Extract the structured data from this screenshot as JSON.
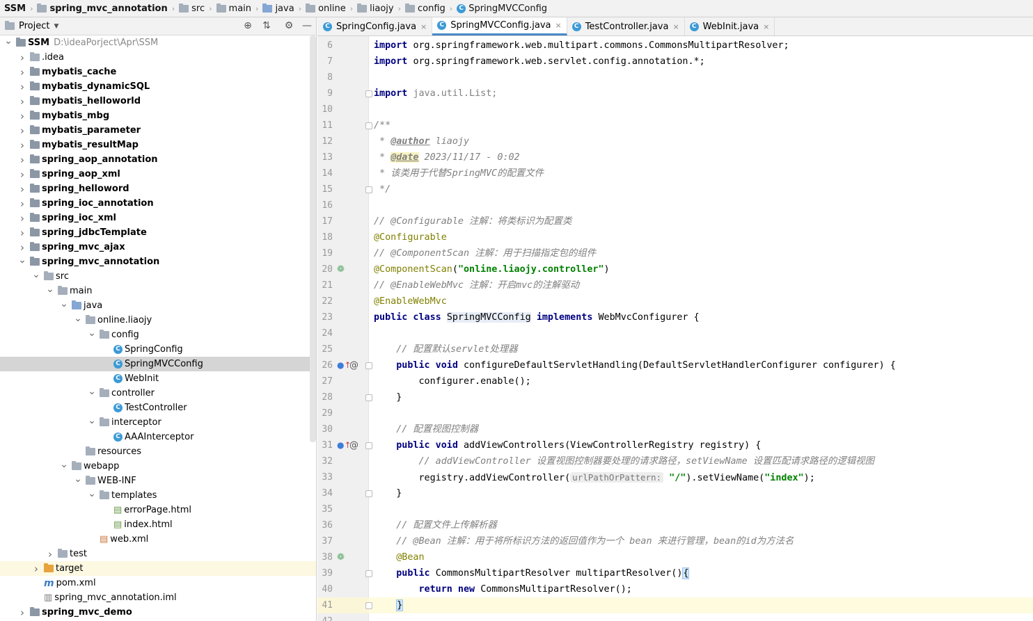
{
  "breadcrumb": [
    "SSM",
    "spring_mvc_annotation",
    "src",
    "main",
    "java",
    "online",
    "liaojy",
    "config",
    "SpringMVCConfig"
  ],
  "sidebar": {
    "title": "Project",
    "tree": [
      {
        "label": "SSM",
        "path": "D:\\ideaPorject\\Apr\\SSM",
        "kind": "project",
        "depth": 0,
        "open": true,
        "bold": true
      },
      {
        "label": ".idea",
        "kind": "folder",
        "depth": 1,
        "closed": true
      },
      {
        "label": "mybatis_cache",
        "kind": "module",
        "depth": 1,
        "closed": true,
        "bold": true
      },
      {
        "label": "mybatis_dynamicSQL",
        "kind": "module",
        "depth": 1,
        "closed": true,
        "bold": true
      },
      {
        "label": "mybatis_helloworld",
        "kind": "module",
        "depth": 1,
        "closed": true,
        "bold": true
      },
      {
        "label": "mybatis_mbg",
        "kind": "module",
        "depth": 1,
        "closed": true,
        "bold": true
      },
      {
        "label": "mybatis_parameter",
        "kind": "module",
        "depth": 1,
        "closed": true,
        "bold": true
      },
      {
        "label": "mybatis_resultMap",
        "kind": "module",
        "depth": 1,
        "closed": true,
        "bold": true
      },
      {
        "label": "spring_aop_annotation",
        "kind": "module",
        "depth": 1,
        "closed": true,
        "bold": true
      },
      {
        "label": "spring_aop_xml",
        "kind": "module",
        "depth": 1,
        "closed": true,
        "bold": true
      },
      {
        "label": "spring_helloword",
        "kind": "module",
        "depth": 1,
        "closed": true,
        "bold": true
      },
      {
        "label": "spring_ioc_annotation",
        "kind": "module",
        "depth": 1,
        "closed": true,
        "bold": true
      },
      {
        "label": "spring_ioc_xml",
        "kind": "module",
        "depth": 1,
        "closed": true,
        "bold": true
      },
      {
        "label": "spring_jdbcTemplate",
        "kind": "module",
        "depth": 1,
        "closed": true,
        "bold": true
      },
      {
        "label": "spring_mvc_ajax",
        "kind": "module",
        "depth": 1,
        "closed": true,
        "bold": true
      },
      {
        "label": "spring_mvc_annotation",
        "kind": "module",
        "depth": 1,
        "open": true,
        "bold": true
      },
      {
        "label": "src",
        "kind": "folder",
        "depth": 2,
        "open": true
      },
      {
        "label": "main",
        "kind": "folder",
        "depth": 3,
        "open": true
      },
      {
        "label": "java",
        "kind": "folder-blue",
        "depth": 4,
        "open": true
      },
      {
        "label": "online.liaojy",
        "kind": "folder",
        "depth": 5,
        "open": true
      },
      {
        "label": "config",
        "kind": "folder",
        "depth": 6,
        "open": true
      },
      {
        "label": "SpringConfig",
        "kind": "class",
        "depth": 7
      },
      {
        "label": "SpringMVCConfig",
        "kind": "class",
        "depth": 7,
        "selected": true
      },
      {
        "label": "WebInit",
        "kind": "class",
        "depth": 7
      },
      {
        "label": "controller",
        "kind": "folder",
        "depth": 6,
        "open": true
      },
      {
        "label": "TestController",
        "kind": "class",
        "depth": 7
      },
      {
        "label": "interceptor",
        "kind": "folder",
        "depth": 6,
        "open": true
      },
      {
        "label": "AAAInterceptor",
        "kind": "class",
        "depth": 7
      },
      {
        "label": "resources",
        "kind": "folder",
        "depth": 5
      },
      {
        "label": "webapp",
        "kind": "folder",
        "depth": 4,
        "open": true
      },
      {
        "label": "WEB-INF",
        "kind": "folder",
        "depth": 5,
        "open": true
      },
      {
        "label": "templates",
        "kind": "folder",
        "depth": 6,
        "open": true
      },
      {
        "label": "errorPage.html",
        "kind": "html",
        "depth": 7
      },
      {
        "label": "index.html",
        "kind": "html",
        "depth": 7
      },
      {
        "label": "web.xml",
        "kind": "xml",
        "depth": 6
      },
      {
        "label": "test",
        "kind": "folder",
        "depth": 3,
        "closed": true
      },
      {
        "label": "target",
        "kind": "folder-orange",
        "depth": 2,
        "closed": true,
        "target": true
      },
      {
        "label": "pom.xml",
        "kind": "maven",
        "depth": 2
      },
      {
        "label": "spring_mvc_annotation.iml",
        "kind": "iml",
        "depth": 2
      },
      {
        "label": "spring_mvc_demo",
        "kind": "module",
        "depth": 1,
        "closed": true,
        "bold": true
      }
    ]
  },
  "tabs": [
    {
      "label": "SpringConfig.java",
      "active": false
    },
    {
      "label": "SpringMVCConfig.java",
      "active": true
    },
    {
      "label": "TestController.java",
      "active": false
    },
    {
      "label": "WebInit.java",
      "active": false
    }
  ],
  "editor": {
    "lines": [
      {
        "n": 6,
        "s": [
          [
            "kw",
            "import"
          ],
          [
            "",
            "org.springframework.web.multipart.commons.CommonsMultipartResolver;"
          ]
        ]
      },
      {
        "n": 7,
        "s": [
          [
            "kw",
            "import"
          ],
          [
            "",
            "org.springframework.web.servlet.config.annotation.*;"
          ]
        ]
      },
      {
        "n": 8,
        "s": []
      },
      {
        "n": 9,
        "fold": true,
        "s": [
          [
            "kw",
            "import"
          ],
          [
            "imp",
            "java.util.List;"
          ]
        ]
      },
      {
        "n": 10,
        "s": []
      },
      {
        "n": 11,
        "fold": true,
        "s": [
          [
            "cm",
            "/**"
          ]
        ]
      },
      {
        "n": 12,
        "s": [
          [
            "cm",
            " * "
          ],
          [
            "tag",
            "@author"
          ],
          [
            "cm",
            " liaojy"
          ]
        ]
      },
      {
        "n": 13,
        "s": [
          [
            "cm",
            " * "
          ],
          [
            "tag hl",
            "@date"
          ],
          [
            "cm",
            " 2023/11/17 - 0:02"
          ]
        ]
      },
      {
        "n": 14,
        "s": [
          [
            "cm",
            " * 该类用于代替SpringMVC的配置文件"
          ]
        ]
      },
      {
        "n": 15,
        "fold": true,
        "s": [
          [
            "cm",
            " */"
          ]
        ]
      },
      {
        "n": 16,
        "s": []
      },
      {
        "n": 17,
        "s": [
          [
            "cm",
            "// @Configurable 注解：将类标识为配置类"
          ]
        ]
      },
      {
        "n": 18,
        "s": [
          [
            "ann",
            "@Configurable"
          ]
        ]
      },
      {
        "n": 19,
        "s": [
          [
            "cm",
            "// @ComponentScan 注解：用于扫描指定包的组件"
          ]
        ]
      },
      {
        "n": 20,
        "mark": "bean",
        "s": [
          [
            "ann",
            "@ComponentScan"
          ],
          [
            "",
            "("
          ],
          [
            "str",
            "\"online.liaojy.controller\""
          ],
          [
            "",
            ")"
          ]
        ]
      },
      {
        "n": 21,
        "s": [
          [
            "cm",
            "// @EnableWebMvc 注解：开启mvc的注解驱动"
          ]
        ]
      },
      {
        "n": 22,
        "s": [
          [
            "ann",
            "@EnableWebMvc"
          ]
        ]
      },
      {
        "n": 23,
        "s": [
          [
            "kw",
            "public class"
          ],
          [
            "clsref",
            "SpringMVCConfig"
          ],
          [
            "kw",
            "implements"
          ],
          [
            "",
            "WebMvcConfigurer {"
          ]
        ]
      },
      {
        "n": 24,
        "s": []
      },
      {
        "n": 25,
        "s": [
          [
            "cm",
            "    // 配置默认servlet处理器"
          ]
        ]
      },
      {
        "n": 26,
        "mark": "override",
        "fold": true,
        "s": [
          [
            "kw",
            "    public void"
          ],
          [
            "",
            "configureDefaultServletHandling(DefaultServletHandlerConfigurer configurer) {"
          ]
        ]
      },
      {
        "n": 27,
        "s": [
          [
            "",
            "        configurer.enable();"
          ]
        ]
      },
      {
        "n": 28,
        "fold": true,
        "s": [
          [
            "",
            "    }"
          ]
        ]
      },
      {
        "n": 29,
        "s": []
      },
      {
        "n": 30,
        "s": [
          [
            "cm",
            "    // 配置视图控制器"
          ]
        ]
      },
      {
        "n": 31,
        "mark": "override",
        "fold": true,
        "s": [
          [
            "kw",
            "    public void"
          ],
          [
            "",
            "addViewControllers(ViewControllerRegistry registry) {"
          ]
        ]
      },
      {
        "n": 32,
        "s": [
          [
            "cm",
            "        // addViewController 设置视图控制器要处理的请求路径，setViewName 设置匹配请求路径的逻辑视图"
          ]
        ]
      },
      {
        "n": 33,
        "s": [
          [
            "",
            "        registry.addViewController("
          ],
          [
            "hint",
            "urlPathOrPattern:"
          ],
          [
            "str",
            "\"/\""
          ],
          [
            "",
            ").setViewName("
          ],
          [
            "str",
            "\"index\""
          ],
          [
            "",
            ");"
          ]
        ]
      },
      {
        "n": 34,
        "fold": true,
        "s": [
          [
            "",
            "    }"
          ]
        ]
      },
      {
        "n": 35,
        "s": []
      },
      {
        "n": 36,
        "s": [
          [
            "cm",
            "    // 配置文件上传解析器"
          ]
        ]
      },
      {
        "n": 37,
        "s": [
          [
            "cm",
            "    // @Bean 注解：用于将所标识方法的返回值作为一个 bean 来进行管理，bean的id为方法名"
          ]
        ]
      },
      {
        "n": 38,
        "mark": "bean",
        "s": [
          [
            "ann",
            "    @Bean"
          ]
        ]
      },
      {
        "n": 39,
        "fold": true,
        "s": [
          [
            "kw",
            "    public"
          ],
          [
            "",
            "CommonsMultipartResolver multipartResolver()"
          ],
          [
            "brace",
            "{"
          ]
        ]
      },
      {
        "n": 40,
        "s": [
          [
            "kw",
            "        return new"
          ],
          [
            "",
            "CommonsMultipartResolver();"
          ]
        ]
      },
      {
        "n": 41,
        "cur": true,
        "fold": true,
        "s": [
          [
            "",
            "    "
          ],
          [
            "brace",
            "}"
          ]
        ]
      },
      {
        "n": 42,
        "s": []
      }
    ]
  }
}
